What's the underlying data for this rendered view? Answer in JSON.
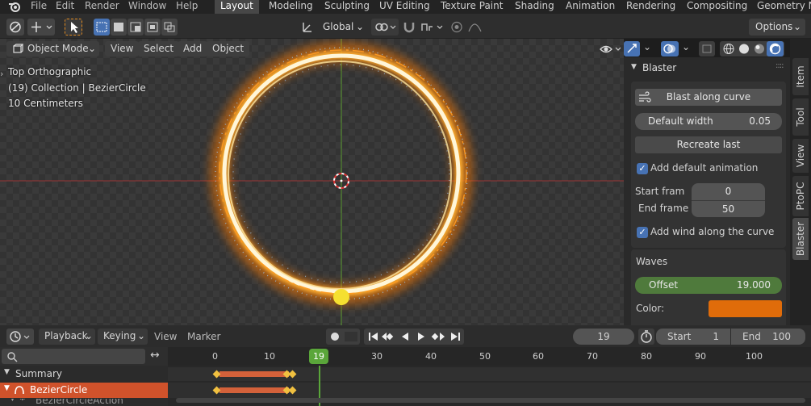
{
  "topbar": {
    "menus": [
      "File",
      "Edit",
      "Render",
      "Window",
      "Help"
    ],
    "workspaces": [
      {
        "label": "Layout",
        "active": true
      },
      {
        "label": "Modeling",
        "active": false
      },
      {
        "label": "Sculpting",
        "active": false
      },
      {
        "label": "UV Editing",
        "active": false
      },
      {
        "label": "Texture Paint",
        "active": false
      },
      {
        "label": "Shading",
        "active": false
      },
      {
        "label": "Animation",
        "active": false
      },
      {
        "label": "Rendering",
        "active": false
      },
      {
        "label": "Compositing",
        "active": false
      },
      {
        "label": "Geometry N",
        "active": false
      }
    ]
  },
  "toolbar": {
    "transform_orientation": "Global",
    "options_label": "Options"
  },
  "viewport_header": {
    "mode": "Object Mode",
    "menus": [
      "View",
      "Select",
      "Add",
      "Object"
    ]
  },
  "overlay": {
    "view_name": "Top Orthographic",
    "collection": "(19) Collection | BezierCircle",
    "scale": "10 Centimeters"
  },
  "npanel": {
    "title": "Blaster",
    "blast_button": "Blast along curve",
    "default_width_label": "Default width",
    "default_width_value": "0.05",
    "recreate_button": "Recreate last",
    "add_anim_label": "Add default animation",
    "add_anim_checked": true,
    "start_frame_label": "Start fram",
    "start_frame_value": "0",
    "end_frame_label": "End frame",
    "end_frame_value": "50",
    "add_wind_label": "Add wind along the curve",
    "add_wind_checked": true,
    "waves_label": "Waves",
    "offset_label": "Offset",
    "offset_value": "19.000",
    "color_label": "Color:",
    "color_value": "#e06c0a"
  },
  "side_tabs": [
    {
      "label": "Item",
      "active": false
    },
    {
      "label": "Tool",
      "active": false
    },
    {
      "label": "View",
      "active": false
    },
    {
      "label": "PtoPC",
      "active": false
    },
    {
      "label": "Blaster",
      "active": true
    }
  ],
  "timeline": {
    "menus": [
      "Playback",
      "Keying",
      "View",
      "Marker"
    ],
    "current_frame": "19",
    "start_label": "Start",
    "start_value": "1",
    "end_label": "End",
    "end_value": "100",
    "ticks": [
      "0",
      "10",
      "19",
      "30",
      "40",
      "50",
      "60",
      "70",
      "80",
      "90",
      "100"
    ],
    "channels": [
      "Summary",
      "BezierCircle",
      "BezierCircleAction"
    ]
  }
}
